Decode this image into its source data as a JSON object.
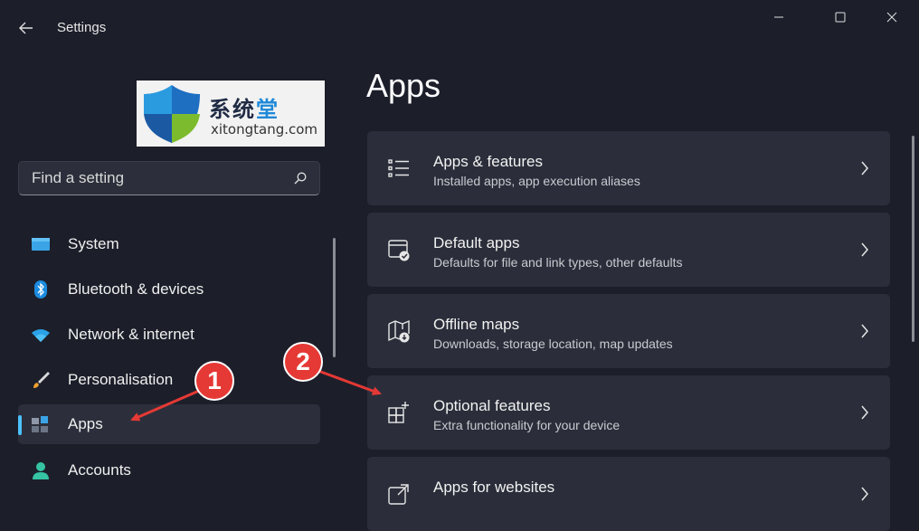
{
  "window": {
    "title": "Settings",
    "back_icon": "back-arrow-icon",
    "controls": [
      "minimize-icon",
      "maximize-icon",
      "close-icon"
    ]
  },
  "logo": {
    "text_cn_main": "系统",
    "text_cn_accent": "堂",
    "text_en": "xitongtang.com"
  },
  "search": {
    "placeholder": "Find a setting",
    "icon": "search-icon"
  },
  "sidebar": {
    "items": [
      {
        "label": "System",
        "icon": "monitor-icon",
        "selected": false
      },
      {
        "label": "Bluetooth & devices",
        "icon": "bluetooth-icon",
        "selected": false
      },
      {
        "label": "Network & internet",
        "icon": "wifi-icon",
        "selected": false
      },
      {
        "label": "Personalisation",
        "icon": "brush-icon",
        "selected": false
      },
      {
        "label": "Apps",
        "icon": "apps-icon",
        "selected": true
      },
      {
        "label": "Accounts",
        "icon": "person-icon",
        "selected": false
      }
    ]
  },
  "main": {
    "title": "Apps",
    "cards": [
      {
        "title": "Apps & features",
        "subtitle": "Installed apps, app execution aliases",
        "icon": "list-icon"
      },
      {
        "title": "Default apps",
        "subtitle": "Defaults for file and link types, other defaults",
        "icon": "default-apps-icon"
      },
      {
        "title": "Offline maps",
        "subtitle": "Downloads, storage location, map updates",
        "icon": "map-icon"
      },
      {
        "title": "Optional features",
        "subtitle": "Extra functionality for your device",
        "icon": "add-grid-icon"
      },
      {
        "title": "Apps for websites",
        "subtitle": "",
        "icon": "open-external-icon"
      }
    ]
  },
  "annotations": {
    "badge_1": "1",
    "badge_2": "2"
  },
  "colors": {
    "background": "#1c1f2a",
    "card": "#2b2e3a",
    "accent": "#4cc2ff",
    "annotation": "#e53935"
  }
}
